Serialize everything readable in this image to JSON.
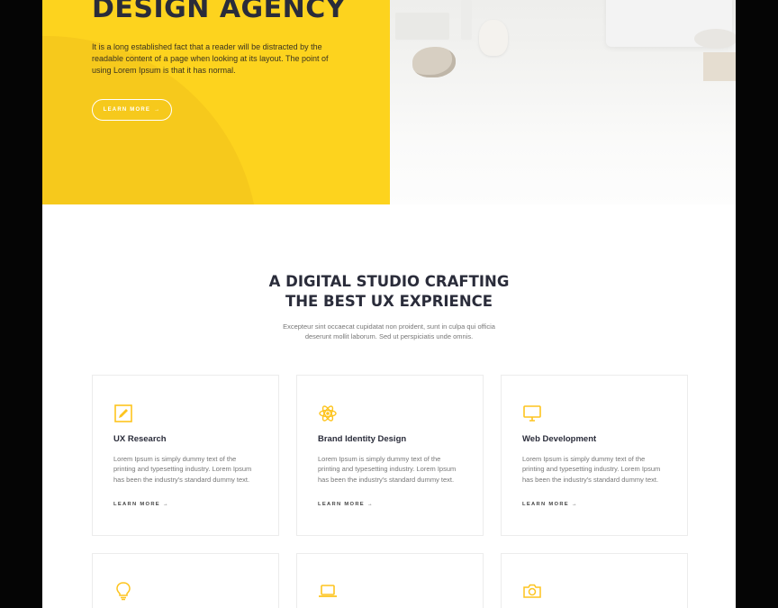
{
  "hero": {
    "title": "DESIGN AGENCY",
    "text": "It is a long established fact that a reader will be distracted by the readable content of a page when looking at its layout. The point of using Lorem Ipsum is that it has normal.",
    "button_label": "LEARN MORE",
    "button_arrow": "→"
  },
  "intro": {
    "title_line1": "A DIGITAL STUDIO CRAFTING",
    "title_line2": "THE BEST UX EXPRIENCE",
    "text": "Excepteur sint occaecat cupidatat non proident, sunt in culpa qui officia deserunt mollit laborum. Sed ut perspiciatis unde omnis."
  },
  "accent_color": "#fdd31e",
  "services": [
    {
      "icon": "pencil-square-icon",
      "title": "UX Research",
      "text": "Lorem Ipsum is simply dummy text of the printing and typesetting industry. Lorem Ipsum has been the industry's standard dummy text.",
      "link": "LEARN MORE →"
    },
    {
      "icon": "atom-icon",
      "title": "Brand Identity Design",
      "text": "Lorem Ipsum is simply dummy text of the printing and typesetting industry. Lorem Ipsum has been the industry's standard dummy text.",
      "link": "LEARN MORE →"
    },
    {
      "icon": "monitor-icon",
      "title": "Web Development",
      "text": "Lorem Ipsum is simply dummy text of the printing and typesetting industry. Lorem Ipsum has been the industry's standard dummy text.",
      "link": "LEARN MORE →"
    }
  ],
  "services_row2": [
    {
      "icon": "lightbulb-icon"
    },
    {
      "icon": "laptop-icon"
    },
    {
      "icon": "camera-icon"
    }
  ]
}
